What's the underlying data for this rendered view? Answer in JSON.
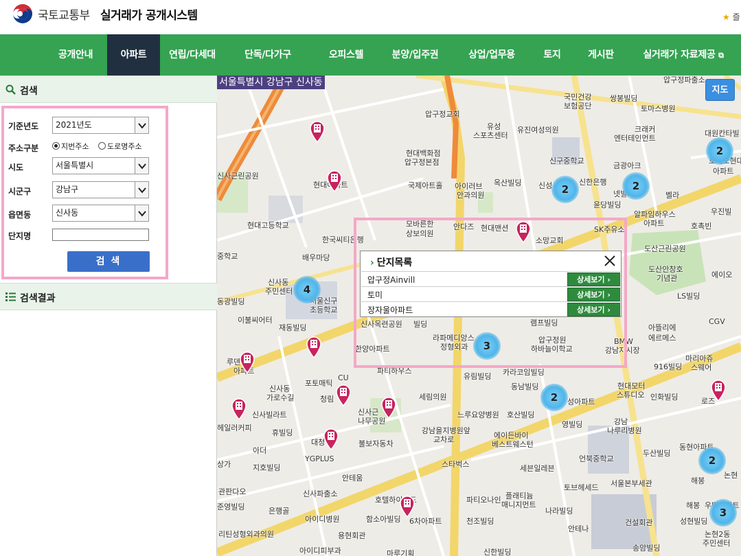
{
  "header": {
    "ministry": "국토교통부",
    "title": "실거래가 공개시스템",
    "favorite": "즐"
  },
  "nav": {
    "items": [
      {
        "label": "공개안내"
      },
      {
        "label": "아파트"
      },
      {
        "label": "연립/다세대"
      },
      {
        "label": "단독/다가구"
      },
      {
        "label": "오피스텔"
      },
      {
        "label": "분양/입주권"
      },
      {
        "label": "상업/업무용"
      },
      {
        "label": "토지"
      },
      {
        "label": "게시판"
      },
      {
        "label": "실거래가 자료제공"
      }
    ],
    "active_index": 1
  },
  "search": {
    "title": "검색",
    "fields": {
      "year_label": "기준년도",
      "year_value": "2021년도",
      "addr_type_label": "주소구분",
      "addr_opt1": "지번주소",
      "addr_opt2": "도로명주소",
      "sido_label": "시도",
      "sido_value": "서울특별시",
      "sigungu_label": "시군구",
      "sigungu_value": "강남구",
      "dong_label": "읍면동",
      "dong_value": "신사동",
      "complex_label": "단지명",
      "complex_value": ""
    },
    "button": "검 색"
  },
  "results": {
    "title": "검색결과"
  },
  "map": {
    "region": "서울특별시 강남구 신사동",
    "toggle": "지도",
    "clusters": [
      "2",
      "2",
      "2",
      "4",
      "3",
      "2",
      "2",
      "3"
    ],
    "labels": [
      "압구정파출소",
      "국민건강",
      "보험공단",
      "쌍봉빌딩",
      "토마스병원",
      "압구정교회",
      "유성",
      "스포츠센터",
      "유진여성의원",
      "현대백화점",
      "압구정본점",
      "신구중학교",
      "크래커",
      "엔터테인먼트",
      "대원칸타빌",
      "로데오현대",
      "아파트",
      "신사근린공원",
      "현대아파트",
      "국제아트홀",
      "아이러브",
      "안과의원",
      "옥산빌딩",
      "신성",
      "신한은행",
      "금광아크",
      "넷빌라트",
      "벨라",
      "윤당빌딩",
      "알파임하우스",
      "아파트",
      "우진빌",
      "현대고등학교",
      "모바른한",
      "상보의원",
      "안다즈",
      "현대맨션",
      "소망교회",
      "SK주유소",
      "호촉빈",
      "중학교",
      "한국씨티은행",
      "도산근린공원",
      "배우마당",
      "도산안창호",
      "기념관",
      "에이오",
      "신사동",
      "주민센터",
      "서울신구",
      "초등학교",
      "동광빌딩",
      "LS빌딩",
      "이불씨어터",
      "재동빌딩",
      "신사목련공원",
      "빌딩",
      "램프빌딩",
      "CGV",
      "아뜰리에",
      "에르메스",
      "한양아파트",
      "라파메디앙스",
      "정형외과",
      "압구정원",
      "하바늘이학교",
      "BMW",
      "강남지시장",
      "916빌딩",
      "마리아쥬",
      "스웨어",
      "루덴",
      "아파트",
      "포토매틱",
      "CU",
      "파티하우스",
      "카라코임빌딩",
      "유림빌딩",
      "현대모터",
      "스튜디오",
      "신사동",
      "가로수길",
      "청림",
      "세림의원",
      "동남빌딩",
      "성아파트",
      "인화빌딩",
      "신사빌라트",
      "신사근",
      "나무공원",
      "느루요양병원",
      "호산빌딩",
      "로즈",
      "헤일러커피",
      "휴빌딩",
      "대청",
      "불보자동차",
      "강남을지병원앞",
      "교차로",
      "에이든바이",
      "베스트웨스턴",
      "영빌딩",
      "강남",
      "나루리병원",
      "아더",
      "YGPLUS",
      "언북중학교",
      "두산빌딩",
      "동현아파트",
      "지호빌딩",
      "안테움",
      "스타벅스",
      "세븐일레븐",
      "논현",
      "관판다오",
      "호텔하이랜드",
      "토브헤세드",
      "서울본부세관",
      "신사파출소",
      "파티오나인",
      "플래티늄",
      "매니지먼트",
      "나라빌딩",
      "준영빌딩",
      "은행골",
      "아이디병원",
      "함소아빌딩",
      "6차아파트",
      "천조빌딩",
      "해봉",
      "우민아파트",
      "성현빌딩",
      "리틴성형외과의원",
      "용현회관",
      "안테나",
      "건설회관",
      "논현2동",
      "주민센터",
      "아이디피부과",
      "마루기획",
      "신한빌딩",
      "송암빌딩",
      "상가",
      "해봉"
    ]
  },
  "popup": {
    "title": "단지목록",
    "rows": [
      {
        "name": "압구정Ainvill",
        "button": "상세보기"
      },
      {
        "name": "토미",
        "button": "상세보기"
      },
      {
        "name": "장자울아파트",
        "button": "상세보기"
      }
    ]
  }
}
